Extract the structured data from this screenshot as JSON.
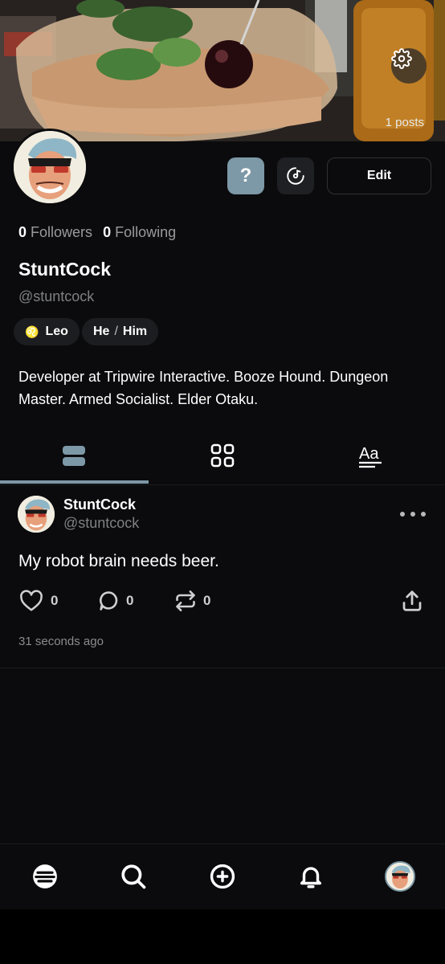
{
  "header": {
    "posts_count": "1 posts",
    "settings_icon": "gear-icon"
  },
  "profile": {
    "help_label": "?",
    "edit_label": "Edit",
    "followers_count": "0",
    "followers_label": "Followers",
    "following_count": "0",
    "following_label": "Following",
    "display_name": "StuntCock",
    "handle": "@stuntcock",
    "zodiac_glyph": "♌",
    "zodiac": "Leo",
    "pronoun_1": "He",
    "pronoun_sep": "/",
    "pronoun_2": "Him",
    "bio": "Developer at Tripwire Interactive. Booze Hound. Dungeon Master. Armed Socialist. Elder Otaku."
  },
  "tabs": [
    {
      "name": "posts",
      "icon": "stacked-posts-icon",
      "active": true
    },
    {
      "name": "grid",
      "icon": "grid-icon",
      "active": false
    },
    {
      "name": "text",
      "icon": "text-aa-icon",
      "active": false
    }
  ],
  "post": {
    "author": "StuntCock",
    "handle": "@stuntcock",
    "body": "My robot brain needs beer.",
    "likes": "0",
    "replies": "0",
    "reposts": "0",
    "time": "31 seconds ago"
  },
  "nav": [
    "home-icon",
    "search-icon",
    "create-icon",
    "bell-icon",
    "profile-avatar"
  ],
  "colors": {
    "accent": "#7d98a6",
    "background": "#0b0b0d"
  }
}
